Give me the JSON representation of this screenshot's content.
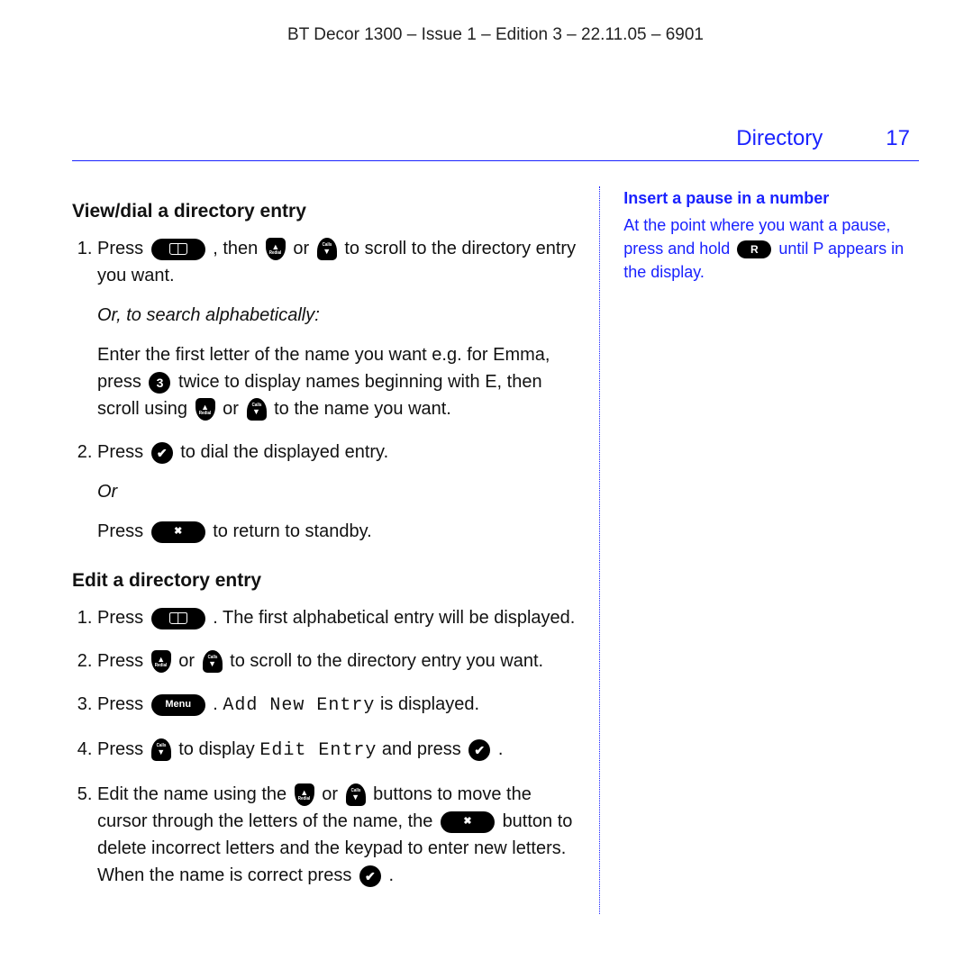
{
  "doc_header": "BT Decor 1300 – Issue 1 – Edition 3 – 22.11.05 – 6901",
  "section": {
    "title": "Directory",
    "page_number": "17"
  },
  "buttons": {
    "menu_label": "Menu",
    "key3_label": "3",
    "r_label": "R"
  },
  "lcd": {
    "add_new_entry": "Add New Entry",
    "edit_entry": "Edit Entry"
  },
  "main": {
    "view_dial": {
      "heading": "View/dial a directory entry",
      "step1_a": "Press ",
      "step1_b": ", then ",
      "step1_c": " or ",
      "step1_d": " to scroll to the directory entry you want.",
      "search_label": "Or, to search alphabetically:",
      "search_body_a": "Enter the first letter of the name you want e.g. for Emma, press ",
      "search_body_b": " twice to display names beginning with E, then scroll using ",
      "search_body_c": " or ",
      "search_body_d": " to the name you want.",
      "step2_a": "Press ",
      "step2_b": " to dial the displayed entry.",
      "or_label": "Or",
      "or_body_a": "Press ",
      "or_body_b": " to return to standby."
    },
    "edit": {
      "heading": "Edit a directory entry",
      "s1_a": "Press ",
      "s1_b": ". The first alphabetical entry will be displayed.",
      "s2_a": "Press ",
      "s2_b": " or ",
      "s2_c": " to scroll to the directory entry you want.",
      "s3_a": "Press ",
      "s3_b": ". ",
      "s3_c": " is displayed.",
      "s4_a": "Press ",
      "s4_b": " to display ",
      "s4_c": " and press ",
      "s4_d": ".",
      "s5_a": "Edit the name using the ",
      "s5_b": " or ",
      "s5_c": " buttons to move the cursor through the letters of the name, the ",
      "s5_d": " button to delete incorrect letters and the keypad to enter new letters. When the name is correct press ",
      "s5_e": "."
    }
  },
  "sidebar": {
    "title": "Insert a pause in a number",
    "body_a": "At the point where you want a pause, press ",
    "body_b_italic": "and hold",
    "body_c": " ",
    "body_d": " until P appears in the display."
  }
}
